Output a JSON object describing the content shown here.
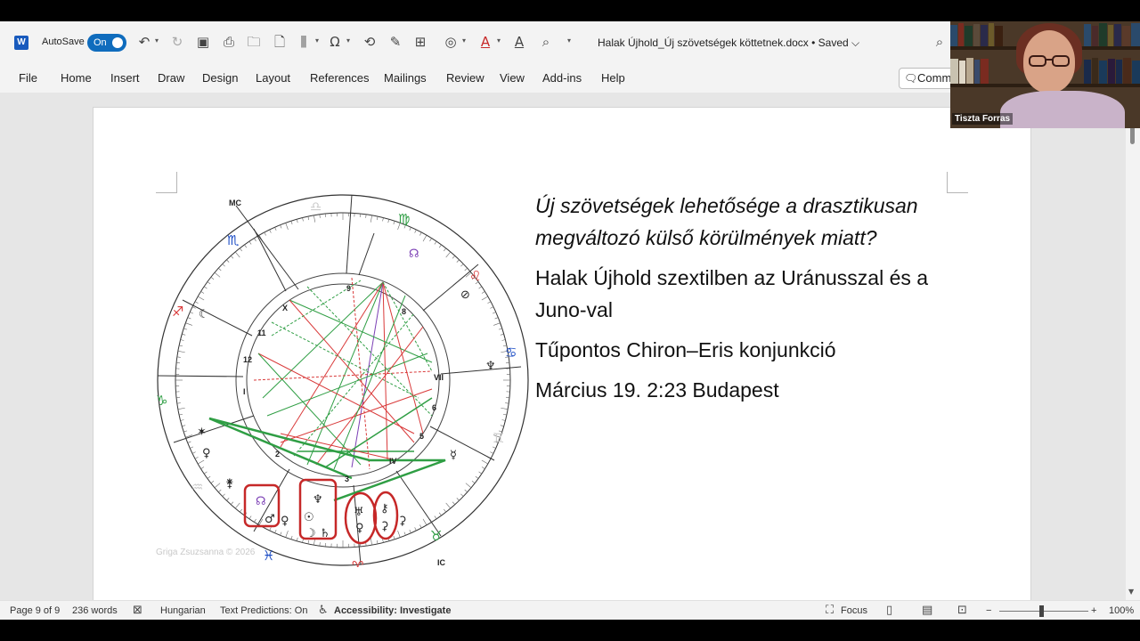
{
  "qat": {
    "autosave_label": "AutoSave",
    "autosave_state": "On",
    "doc_title": "Halak Újhold_Új szövetségek köttetnek.docx  •  Saved  ⌵"
  },
  "tabs": [
    "File",
    "Home",
    "Insert",
    "Draw",
    "Design",
    "Layout",
    "References",
    "Mailings",
    "Review",
    "View",
    "Add-ins",
    "Help"
  ],
  "comments_label": "Comments",
  "document": {
    "line1": "Új szövetségek lehetősége a drasztikusan megváltozó külső körülmények miatt?",
    "line2": "Halak Újhold szextilben az Uránusszal és a Juno-val",
    "line3": "Tűpontos Chiron–Eris konjunkció",
    "line4": "Március 19. 2:23 Budapest",
    "copyright": "Griga Zsuzsanna © 2026"
  },
  "chart_labels": {
    "mc": "MC",
    "ic": "IC",
    "houses": [
      "9",
      "8",
      "VII",
      "6",
      "5",
      "IV",
      "3",
      "2",
      "I",
      "12",
      "11",
      "X"
    ]
  },
  "status": {
    "page": "Page 9 of 9",
    "words": "236 words",
    "language": "Hungarian",
    "predictions": "Text Predictions: On",
    "accessibility": "Accessibility: Investigate",
    "focus": "Focus",
    "zoom": "100%"
  },
  "webcam": {
    "name": "Tiszta Forras"
  },
  "colors": {
    "accent": "#0f6cbd",
    "word_blue": "#185abd",
    "aspect_red": "#d93a3a",
    "aspect_green": "#2f9e44",
    "highlight_box": "#c62828"
  }
}
